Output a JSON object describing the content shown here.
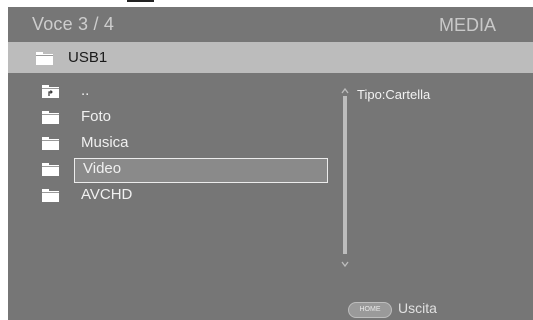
{
  "header": {
    "item_counter": "Voce 3 / 4",
    "mode_title": "MEDIA"
  },
  "path": {
    "current": "USB1",
    "icon": "folder-icon"
  },
  "file_list": {
    "items": [
      {
        "label": "..",
        "icon": "folder-up-icon",
        "selected": false
      },
      {
        "label": "Foto",
        "icon": "folder-icon",
        "selected": false
      },
      {
        "label": "Musica",
        "icon": "folder-icon",
        "selected": false
      },
      {
        "label": "Video",
        "icon": "folder-icon",
        "selected": true
      },
      {
        "label": "AVCHD",
        "icon": "folder-icon",
        "selected": false
      }
    ]
  },
  "info_panel": {
    "type_text": "Tipo:Cartella"
  },
  "footer": {
    "home_button_label": "HOME",
    "exit_label": "Uscita"
  },
  "colors": {
    "screen_background": "#767676",
    "path_bar_background": "#bcbcbc",
    "selection_border": "#ececec",
    "text_light": "#f0f0f0"
  }
}
